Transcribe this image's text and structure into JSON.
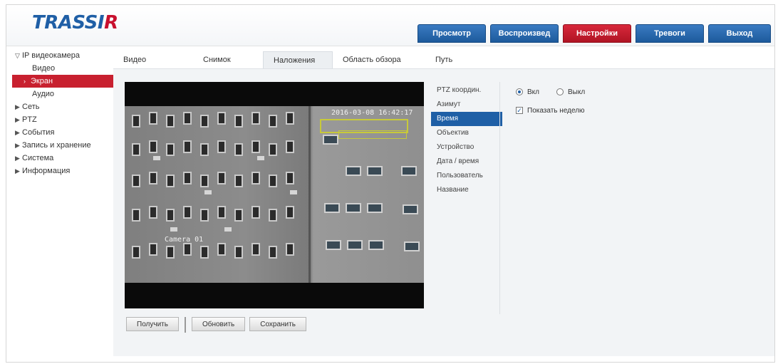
{
  "header": {
    "logo_main": "TRASSI",
    "logo_accent": "R",
    "nav": [
      {
        "label": "Просмотр",
        "active": false
      },
      {
        "label": "Воспроизвед",
        "active": false
      },
      {
        "label": "Настройки",
        "active": true
      },
      {
        "label": "Тревоги",
        "active": false
      },
      {
        "label": "Выход",
        "active": false
      }
    ]
  },
  "sidebar": {
    "items": [
      {
        "label": "IP видеокамера",
        "arrow": "▽",
        "kind": "root"
      },
      {
        "label": "Видео",
        "arrow": "",
        "kind": "sub"
      },
      {
        "label": "Экран",
        "arrow": "›",
        "kind": "selected"
      },
      {
        "label": "Аудио",
        "arrow": "",
        "kind": "sub"
      },
      {
        "label": "Сеть",
        "arrow": "▶",
        "kind": "root"
      },
      {
        "label": "PTZ",
        "arrow": "▶",
        "kind": "root"
      },
      {
        "label": "События",
        "arrow": "▶",
        "kind": "root"
      },
      {
        "label": "Запись и хранение",
        "arrow": "▶",
        "kind": "root"
      },
      {
        "label": "Система",
        "arrow": "▶",
        "kind": "root"
      },
      {
        "label": "Информация",
        "arrow": "▶",
        "kind": "root"
      }
    ]
  },
  "tabs": [
    {
      "label": "Видео",
      "active": false
    },
    {
      "label": "Снимок",
      "active": false
    },
    {
      "label": "Наложения",
      "active": true
    },
    {
      "label": "Область обзора",
      "active": false
    },
    {
      "label": "Путь",
      "active": false
    }
  ],
  "video": {
    "osd_time": "2016-03-08 16:42:17",
    "osd_name": "Camera 01"
  },
  "video_buttons": [
    {
      "label": "Получить"
    },
    {
      "label": "Обновить"
    },
    {
      "label": "Сохранить"
    }
  ],
  "submenu": [
    {
      "label": "PTZ координ.",
      "selected": false
    },
    {
      "label": "Азимут",
      "selected": false
    },
    {
      "label": "Время",
      "selected": true
    },
    {
      "label": "Объектив",
      "selected": false
    },
    {
      "label": "Устройство",
      "selected": false
    },
    {
      "label": "Дата / время",
      "selected": false
    },
    {
      "label": "Пользователь",
      "selected": false
    },
    {
      "label": "Название",
      "selected": false
    }
  ],
  "options": {
    "radio_on_label": "Вкл",
    "radio_off_label": "Выкл",
    "checkbox_label": "Показать неделю"
  },
  "colors": {
    "nav_blue": "#1d5a9c",
    "nav_red": "#b01424",
    "sidebar_selected": "#c8202f",
    "submenu_selected": "#1f5fa6"
  }
}
